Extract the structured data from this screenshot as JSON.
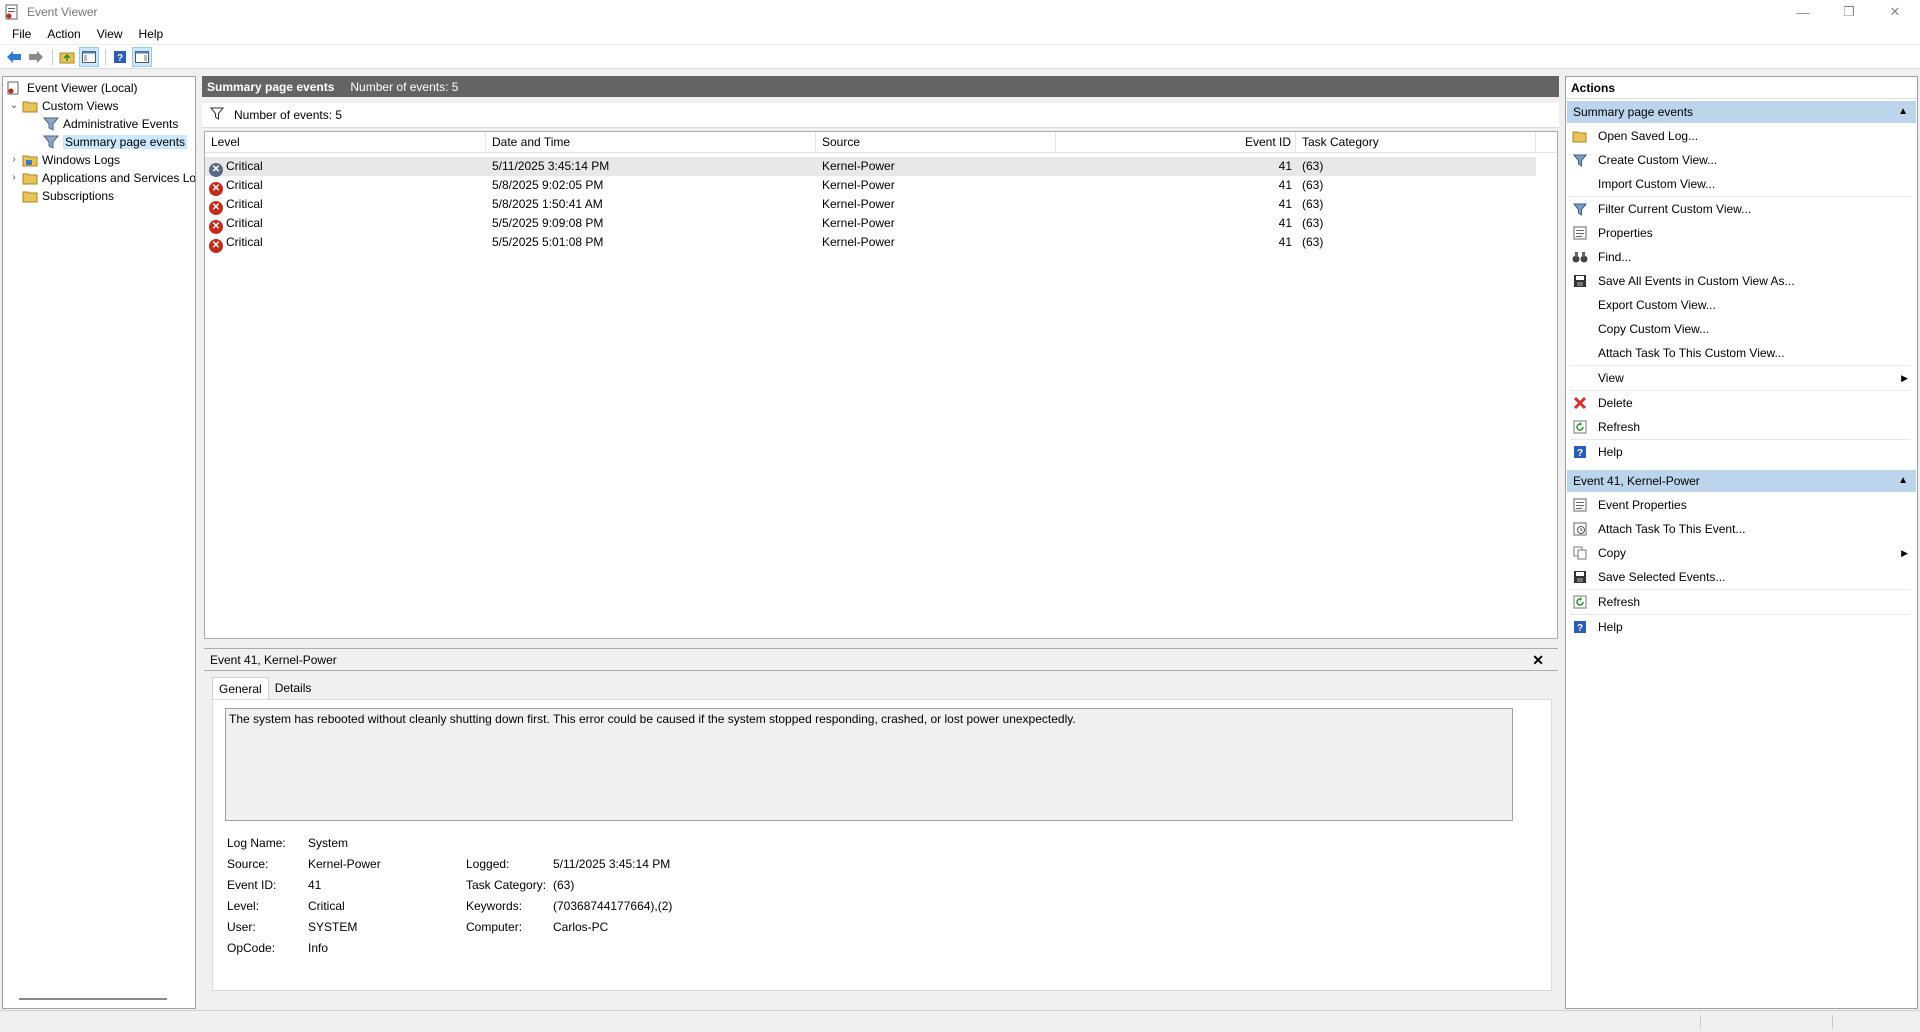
{
  "window": {
    "title": "Event Viewer",
    "minimize": "—",
    "restore": "❐",
    "close": "✕"
  },
  "menu": [
    "File",
    "Action",
    "View",
    "Help"
  ],
  "toolbar": {
    "icons": [
      "back-arrow-icon",
      "forward-arrow-icon",
      "folder-up-icon",
      "show-hide-tree-icon",
      "help-icon",
      "show-hide-action-pane-icon"
    ]
  },
  "tree": {
    "root": "Event Viewer (Local)",
    "custom_views": "Custom Views",
    "administrative_events": "Administrative Events",
    "summary_page_events": "Summary page events",
    "windows_logs": "Windows Logs",
    "applications_services": "Applications and Services Lo",
    "subscriptions": "Subscriptions"
  },
  "center": {
    "header_title": "Summary page events",
    "header_count": "Number of events: 5",
    "filter_text": "Number of events: 5",
    "columns": [
      "Level",
      "Date and Time",
      "Source",
      "Event ID",
      "Task Category"
    ],
    "rows": [
      {
        "level": "Critical",
        "datetime": "5/11/2025 3:45:14 PM",
        "source": "Kernel-Power",
        "event_id": "41",
        "task_category": "(63)"
      },
      {
        "level": "Critical",
        "datetime": "5/8/2025 9:02:05 PM",
        "source": "Kernel-Power",
        "event_id": "41",
        "task_category": "(63)"
      },
      {
        "level": "Critical",
        "datetime": "5/8/2025 1:50:41 AM",
        "source": "Kernel-Power",
        "event_id": "41",
        "task_category": "(63)"
      },
      {
        "level": "Critical",
        "datetime": "5/5/2025 9:09:08 PM",
        "source": "Kernel-Power",
        "event_id": "41",
        "task_category": "(63)"
      },
      {
        "level": "Critical",
        "datetime": "5/5/2025 5:01:08 PM",
        "source": "Kernel-Power",
        "event_id": "41",
        "task_category": "(63)"
      }
    ]
  },
  "detail": {
    "title": "Event 41, Kernel-Power",
    "close": "✕",
    "tabs": [
      "General",
      "Details"
    ],
    "message": "The system has rebooted without cleanly shutting down first. This error could be caused if the system stopped responding, crashed, or lost power unexpectedly.",
    "fields": {
      "log_name_label": "Log Name:",
      "log_name": "System",
      "source_label": "Source:",
      "source": "Kernel-Power",
      "event_id_label": "Event ID:",
      "event_id": "41",
      "level_label": "Level:",
      "level": "Critical",
      "user_label": "User:",
      "user": "SYSTEM",
      "opcode_label": "OpCode:",
      "opcode": "Info",
      "logged_label": "Logged:",
      "logged": "5/11/2025 3:45:14 PM",
      "task_category_label": "Task Category:",
      "task_category": "(63)",
      "keywords_label": "Keywords:",
      "keywords": "(70368744177664),(2)",
      "computer_label": "Computer:",
      "computer": "Carlos-PC"
    }
  },
  "actions": {
    "title": "Actions",
    "section1": "Summary page events",
    "section1_items": [
      "Open Saved Log...",
      "Create Custom View...",
      "Import Custom View...",
      "Filter Current Custom View...",
      "Properties",
      "Find...",
      "Save All Events in Custom View As...",
      "Export Custom View...",
      "Copy Custom View...",
      "Attach Task To This Custom View...",
      "View",
      "Delete",
      "Refresh",
      "Help"
    ],
    "section2": "Event 41, Kernel-Power",
    "section2_items": [
      "Event Properties",
      "Attach Task To This Event...",
      "Copy",
      "Save Selected Events...",
      "Refresh",
      "Help"
    ]
  },
  "colors": {
    "header_bg": "#646464",
    "section_bg": "#bcd4ec",
    "critical": "#c42b1c",
    "selected_tree": "#cce8ff"
  }
}
